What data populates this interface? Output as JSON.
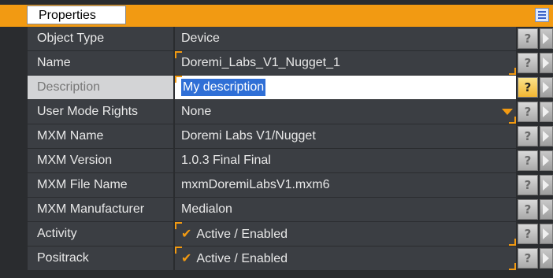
{
  "header": {
    "tab_label": "Properties",
    "menu_icon": "list-icon"
  },
  "colors": {
    "accent": "#f29a12",
    "row_bg": "#3b3e43",
    "selection": "#2f6fd6"
  },
  "rows": [
    {
      "label": "Object Type",
      "value": "Device",
      "help": "?",
      "icon": "help-icon"
    },
    {
      "label": "Name",
      "value": "Doremi_Labs_V1_Nugget_1",
      "help": "?"
    },
    {
      "label": "Description",
      "value": "My description",
      "help": "?"
    },
    {
      "label": "User Mode Rights",
      "value": "None",
      "help": "?"
    },
    {
      "label": "MXM Name",
      "value": "Doremi Labs V1/Nugget",
      "help": "?"
    },
    {
      "label": "MXM Version",
      "value": "1.0.3 Final Final",
      "help": "?"
    },
    {
      "label": "MXM File Name",
      "value": "mxmDoremiLabsV1.mxm6",
      "help": "?"
    },
    {
      "label": "MXM Manufacturer",
      "value": "Medialon",
      "help": "?"
    },
    {
      "label": "Activity",
      "value": "Active / Enabled",
      "check": "✔",
      "help": "?"
    },
    {
      "label": "Positrack",
      "value": "Active / Enabled",
      "check": "✔",
      "help": "?"
    }
  ]
}
